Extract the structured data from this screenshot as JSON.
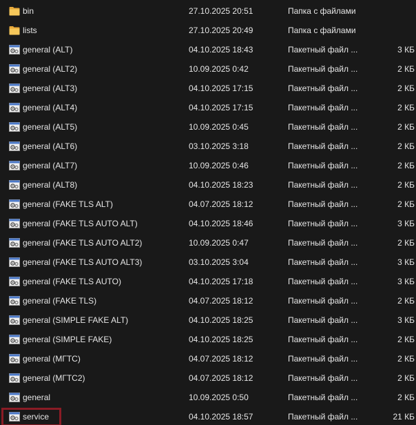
{
  "files": [
    {
      "name": "bin",
      "date": "27.10.2025 20:51",
      "type": "Папка с файлами",
      "size": "",
      "icon": "folder-icon"
    },
    {
      "name": "lists",
      "date": "27.10.2025 20:49",
      "type": "Папка с файлами",
      "size": "",
      "icon": "folder-icon"
    },
    {
      "name": "general (ALT)",
      "date": "04.10.2025 18:43",
      "type": "Пакетный файл ...",
      "size": "3 КБ",
      "icon": "batch-file-icon"
    },
    {
      "name": "general (ALT2)",
      "date": "10.09.2025 0:42",
      "type": "Пакетный файл ...",
      "size": "2 КБ",
      "icon": "batch-file-icon"
    },
    {
      "name": "general (ALT3)",
      "date": "04.10.2025 17:15",
      "type": "Пакетный файл ...",
      "size": "2 КБ",
      "icon": "batch-file-icon"
    },
    {
      "name": "general (ALT4)",
      "date": "04.10.2025 17:15",
      "type": "Пакетный файл ...",
      "size": "2 КБ",
      "icon": "batch-file-icon"
    },
    {
      "name": "general (ALT5)",
      "date": "10.09.2025 0:45",
      "type": "Пакетный файл ...",
      "size": "2 КБ",
      "icon": "batch-file-icon"
    },
    {
      "name": "general (ALT6)",
      "date": "03.10.2025 3:18",
      "type": "Пакетный файл ...",
      "size": "2 КБ",
      "icon": "batch-file-icon"
    },
    {
      "name": "general (ALT7)",
      "date": "10.09.2025 0:46",
      "type": "Пакетный файл ...",
      "size": "2 КБ",
      "icon": "batch-file-icon"
    },
    {
      "name": "general (ALT8)",
      "date": "04.10.2025 18:23",
      "type": "Пакетный файл ...",
      "size": "2 КБ",
      "icon": "batch-file-icon"
    },
    {
      "name": "general (FAKE TLS ALT)",
      "date": "04.07.2025 18:12",
      "type": "Пакетный файл ...",
      "size": "2 КБ",
      "icon": "batch-file-icon"
    },
    {
      "name": "general (FAKE TLS AUTO ALT)",
      "date": "04.10.2025 18:46",
      "type": "Пакетный файл ...",
      "size": "3 КБ",
      "icon": "batch-file-icon"
    },
    {
      "name": "general (FAKE TLS AUTO ALT2)",
      "date": "10.09.2025 0:47",
      "type": "Пакетный файл ...",
      "size": "2 КБ",
      "icon": "batch-file-icon"
    },
    {
      "name": "general (FAKE TLS AUTO ALT3)",
      "date": "03.10.2025 3:04",
      "type": "Пакетный файл ...",
      "size": "3 КБ",
      "icon": "batch-file-icon"
    },
    {
      "name": "general (FAKE TLS AUTO)",
      "date": "04.10.2025 17:18",
      "type": "Пакетный файл ...",
      "size": "3 КБ",
      "icon": "batch-file-icon"
    },
    {
      "name": "general (FAKE TLS)",
      "date": "04.07.2025 18:12",
      "type": "Пакетный файл ...",
      "size": "2 КБ",
      "icon": "batch-file-icon"
    },
    {
      "name": "general (SIMPLE FAKE ALT)",
      "date": "04.10.2025 18:25",
      "type": "Пакетный файл ...",
      "size": "3 КБ",
      "icon": "batch-file-icon"
    },
    {
      "name": "general (SIMPLE FAKE)",
      "date": "04.10.2025 18:25",
      "type": "Пакетный файл ...",
      "size": "2 КБ",
      "icon": "batch-file-icon"
    },
    {
      "name": "general (МГТС)",
      "date": "04.07.2025 18:12",
      "type": "Пакетный файл ...",
      "size": "2 КБ",
      "icon": "batch-file-icon"
    },
    {
      "name": "general (МГТС2)",
      "date": "04.07.2025 18:12",
      "type": "Пакетный файл ...",
      "size": "2 КБ",
      "icon": "batch-file-icon"
    },
    {
      "name": "general",
      "date": "10.09.2025 0:50",
      "type": "Пакетный файл ...",
      "size": "2 КБ",
      "icon": "batch-file-icon"
    },
    {
      "name": "service",
      "date": "04.10.2025 18:57",
      "type": "Пакетный файл ...",
      "size": "21 КБ",
      "icon": "batch-file-icon",
      "highlighted": true
    }
  ],
  "colors": {
    "background": "#191919",
    "text": "#e6e6e6",
    "highlight": "#8a1c25",
    "folder": "#f2c04d"
  }
}
